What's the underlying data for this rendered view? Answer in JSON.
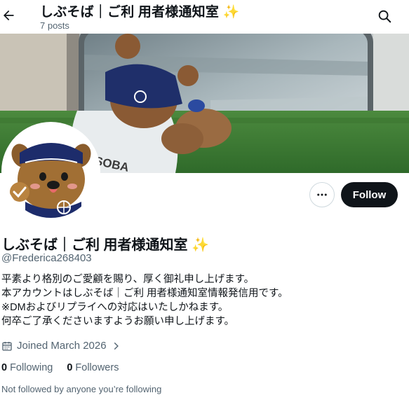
{
  "header": {
    "title": "しぶそば｜ご利 用者様通知室 ✨",
    "post_count": "7 posts"
  },
  "banner": {
    "shirt_text": "U SOBA"
  },
  "profile": {
    "display_name": "しぶそば｜ご利 用者様通知室 ✨",
    "handle": "@Frederica268403",
    "follow_label": "Follow",
    "bio": [
      "平素より格別のご愛顧を賜り、厚く御礼申し上げます。",
      "本アカウントはしぶそば｜ご利 用者様通知室情報発信用です。",
      "※DMおよびリプライへの対応はいたしかねます。",
      "何卒ご了承くださいますようお願い申し上げます。"
    ],
    "joined": "Joined March 2026",
    "following_count": "0",
    "following_label": "Following",
    "followers_count": "0",
    "followers_label": "Followers",
    "not_followed": "Not followed by anyone you’re following"
  },
  "icons": {
    "back": "arrow-left-icon",
    "search": "search-icon",
    "more": "more-horizontal-icon",
    "calendar": "calendar-icon",
    "chevron": "chevron-right-icon"
  },
  "colors": {
    "text": "#0f1419",
    "secondary": "#536471",
    "button": "#0f1419",
    "border": "#cfd9de"
  }
}
